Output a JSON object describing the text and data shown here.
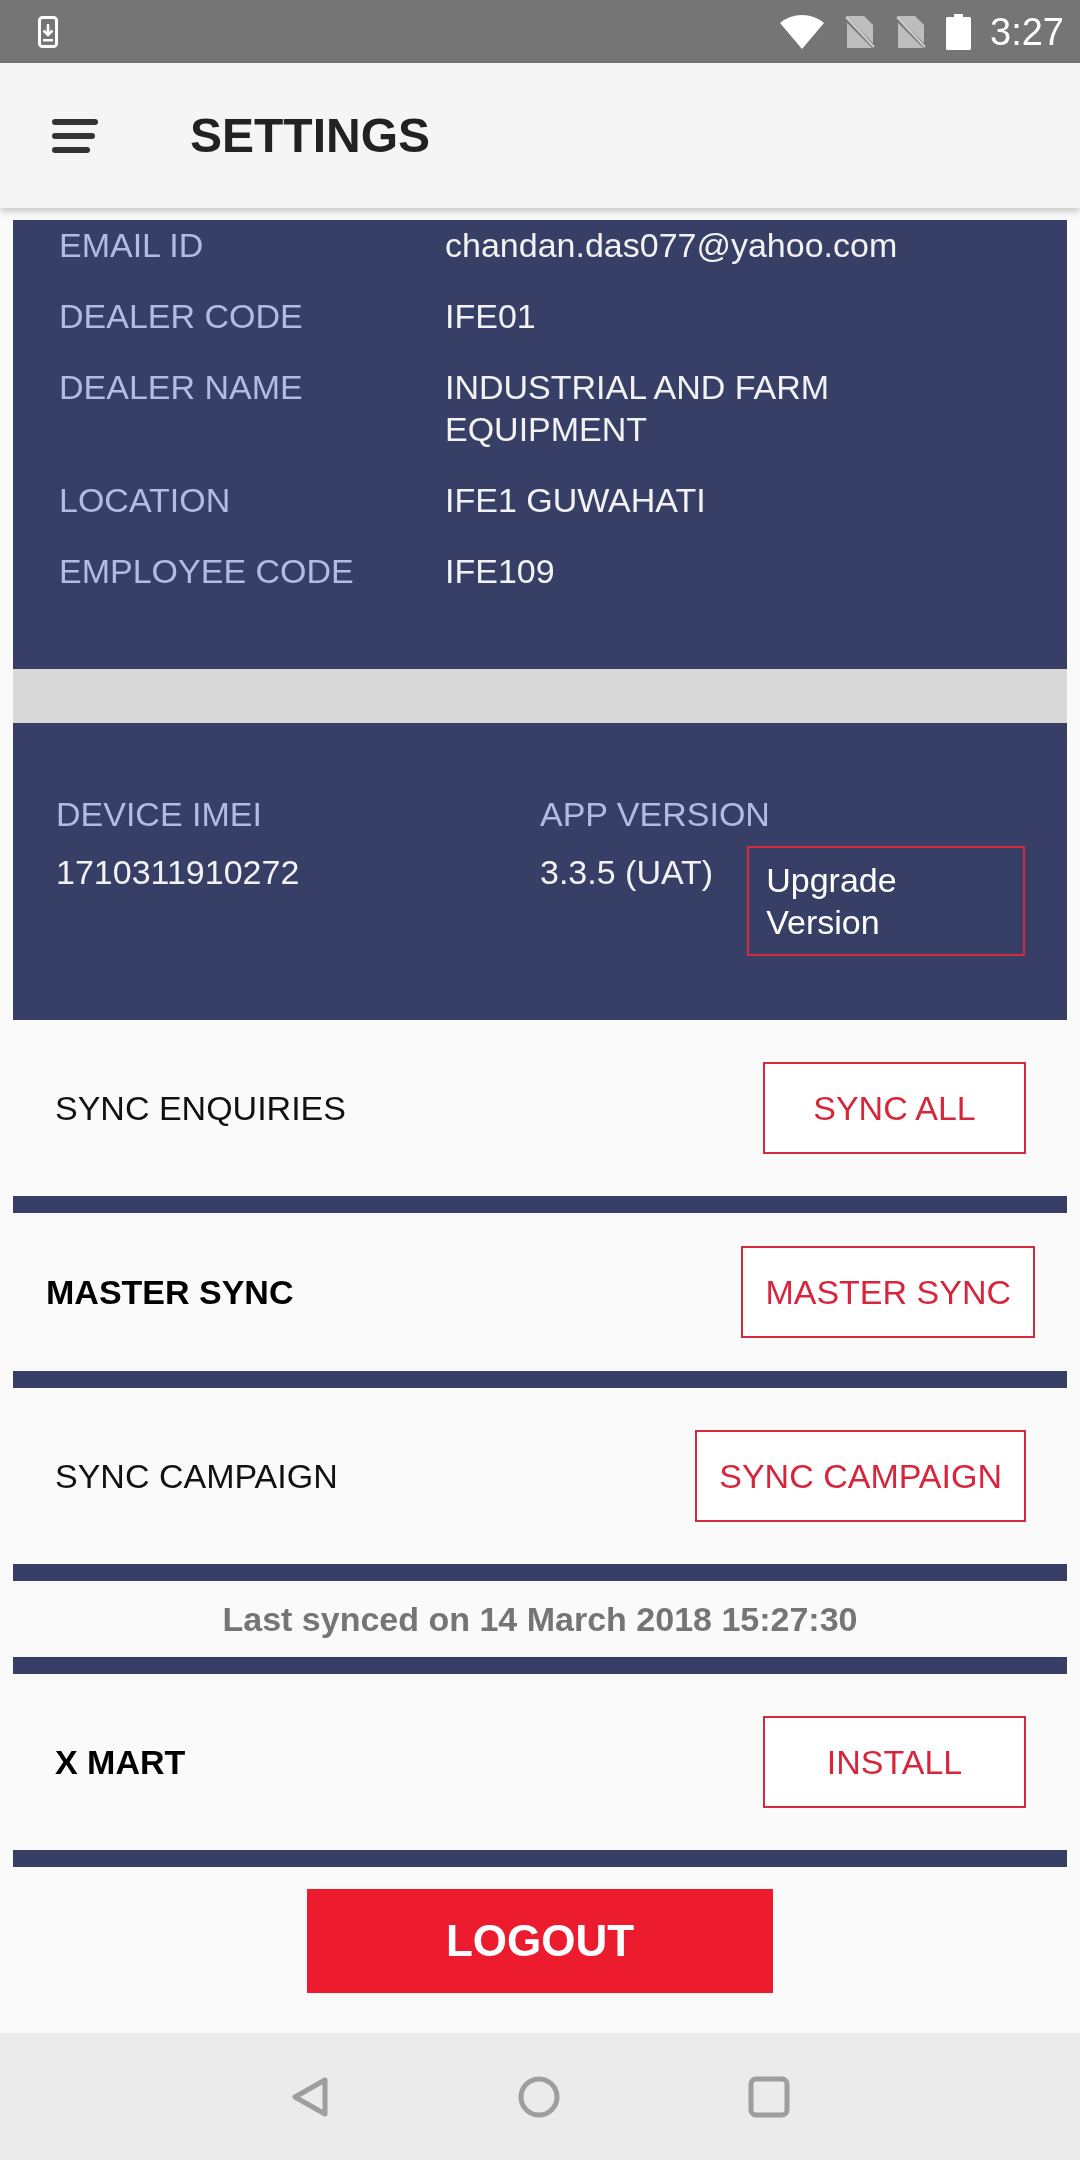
{
  "status_bar": {
    "time": "3:27"
  },
  "header": {
    "title": "SETTINGS"
  },
  "profile": [
    {
      "label": "EMAIL ID",
      "value": "chandan.das077@yahoo.com"
    },
    {
      "label": "DEALER CODE",
      "value": "IFE01"
    },
    {
      "label": "DEALER NAME",
      "value": "INDUSTRIAL AND FARM EQUIPMENT"
    },
    {
      "label": "LOCATION",
      "value": "IFE1 GUWAHATI"
    },
    {
      "label": "EMPLOYEE CODE",
      "value": "IFE109"
    }
  ],
  "device": {
    "imei_label": "DEVICE IMEI",
    "imei": "1710311910272",
    "version_label": "APP VERSION",
    "version": "3.3.5 (UAT)",
    "upgrade_button": "Upgrade Version"
  },
  "actions": [
    {
      "kind": "plain",
      "label": "SYNC ENQUIRIES",
      "button": "SYNC ALL"
    },
    {
      "kind": "master",
      "label": "MASTER SYNC",
      "button": "MASTER SYNC"
    },
    {
      "kind": "plain",
      "label": "SYNC CAMPAIGN",
      "button": "SYNC CAMPAIGN"
    },
    {
      "kind": "note",
      "text": "Last synced on 14 March 2018 15:27:30"
    },
    {
      "kind": "app",
      "label": "X MART",
      "button": "INSTALL"
    }
  ],
  "logout_button": "LOGOUT"
}
